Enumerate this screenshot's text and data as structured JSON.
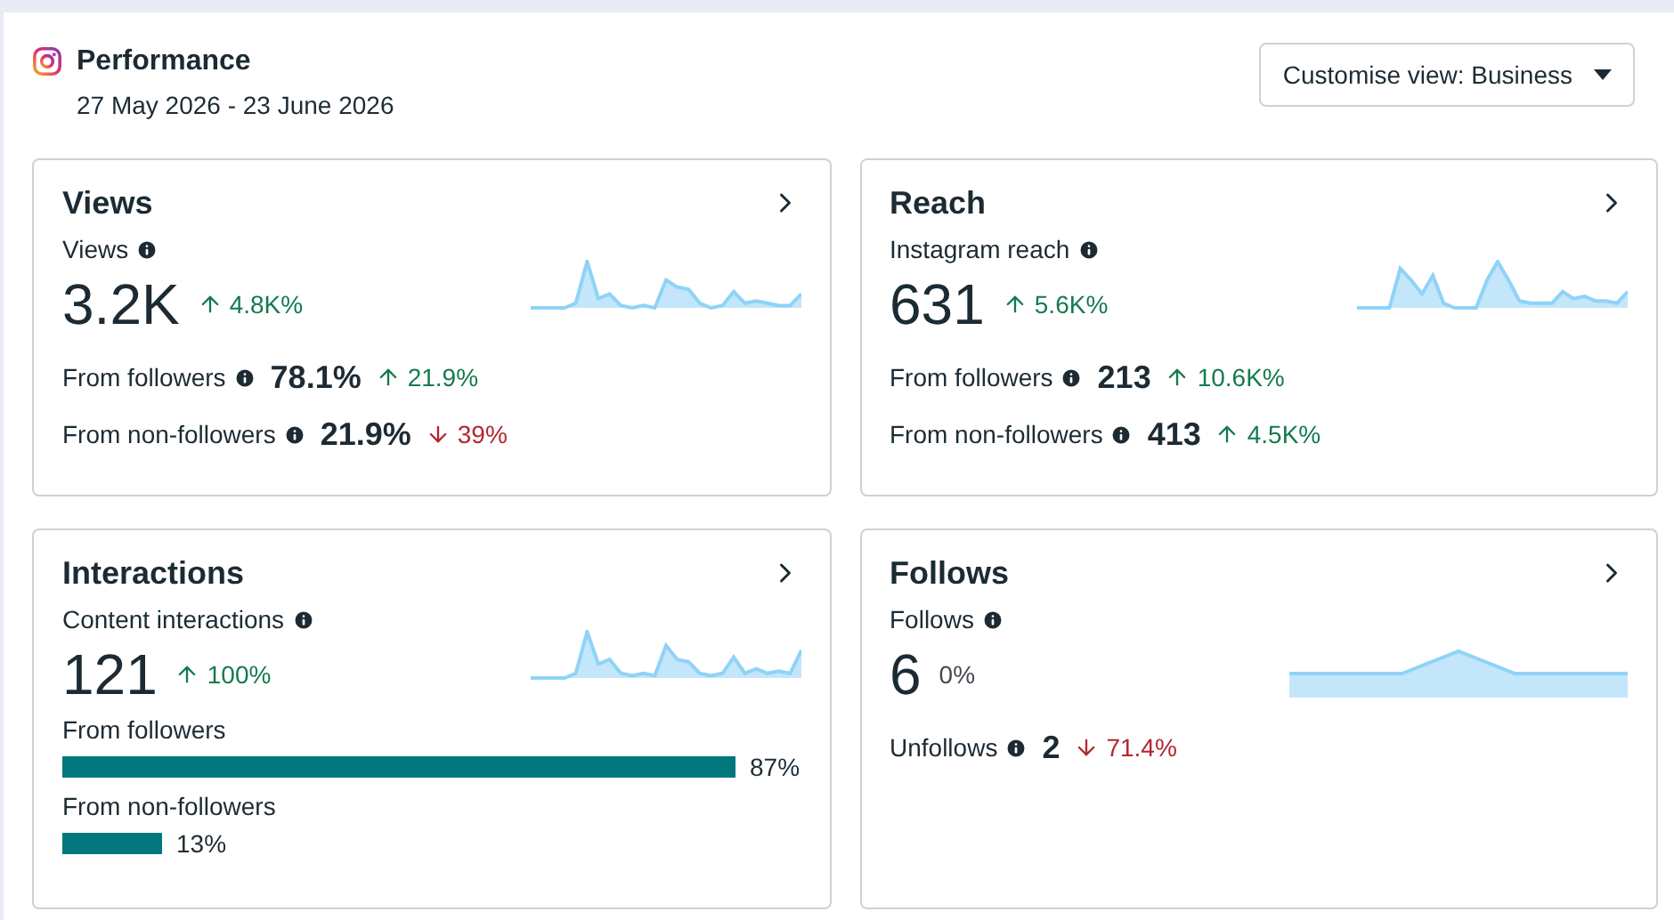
{
  "header": {
    "title": "Performance",
    "date_range": "27 May 2026 - 23 June 2026",
    "customise_button": "Customise view: Business"
  },
  "cards": [
    {
      "title": "Views",
      "metric_label": "Views",
      "value": "3.2K",
      "change": {
        "text": "4.8K%",
        "kind": "up"
      },
      "rows": [
        {
          "kind": "change",
          "label": "From followers",
          "value": "78.1%",
          "change": {
            "text": "21.9%",
            "kind": "up"
          }
        },
        {
          "kind": "change",
          "label": "From non-followers",
          "value": "21.9%",
          "change": {
            "text": "39%",
            "kind": "down"
          }
        }
      ]
    },
    {
      "title": "Reach",
      "metric_label": "Instagram reach",
      "value": "631",
      "change": {
        "text": "5.6K%",
        "kind": "up"
      },
      "rows": [
        {
          "kind": "change",
          "label": "From followers",
          "value": "213",
          "change": {
            "text": "10.6K%",
            "kind": "up"
          }
        },
        {
          "kind": "change",
          "label": "From non-followers",
          "value": "413",
          "change": {
            "text": "4.5K%",
            "kind": "up"
          }
        }
      ]
    },
    {
      "title": "Interactions",
      "metric_label": "Content interactions",
      "value": "121",
      "change": {
        "text": "100%",
        "kind": "up"
      },
      "rows": [
        {
          "kind": "bar",
          "label": "From followers",
          "reading": "87%"
        },
        {
          "kind": "bar",
          "label": "From non-followers",
          "reading": "13%"
        }
      ]
    },
    {
      "title": "Follows",
      "metric_label": "Follows",
      "value": "6",
      "change": {
        "text": "0%",
        "kind": "flat"
      },
      "rows": [
        {
          "kind": "change",
          "label": "Unfollows",
          "value": "2",
          "change": {
            "text": "71.4%",
            "kind": "down"
          }
        }
      ]
    }
  ]
}
